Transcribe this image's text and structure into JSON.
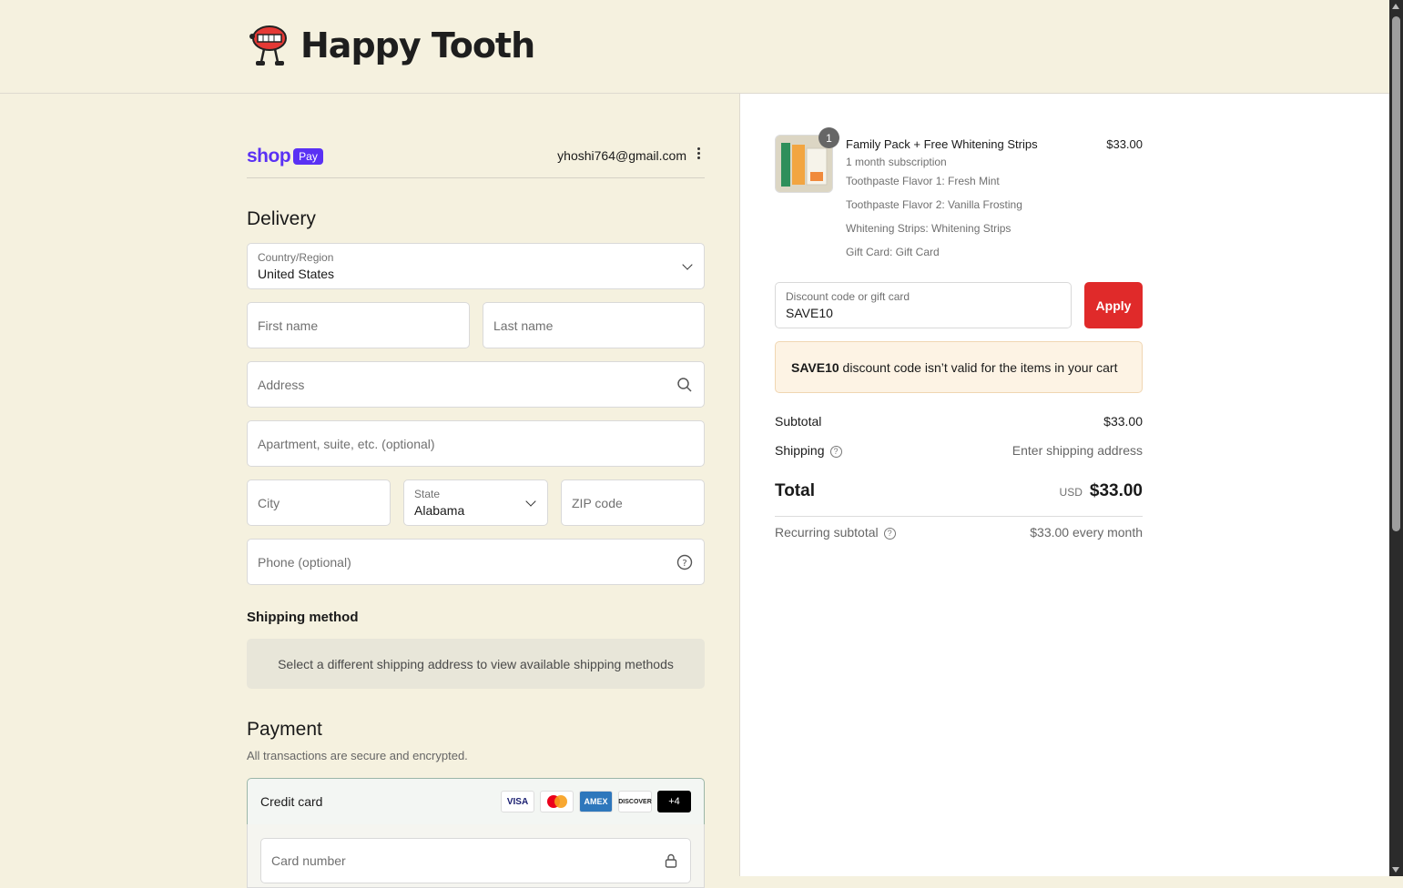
{
  "brand": {
    "name": "Happy Tooth"
  },
  "shoppay": {
    "logo_word": "shop",
    "badge": "Pay",
    "email": "yhoshi764@gmail.com"
  },
  "delivery": {
    "title": "Delivery",
    "country": {
      "label": "Country/Region",
      "value": "United States"
    },
    "first_name": {
      "placeholder": "First name"
    },
    "last_name": {
      "placeholder": "Last name"
    },
    "address": {
      "placeholder": "Address"
    },
    "apartment": {
      "placeholder": "Apartment, suite, etc. (optional)"
    },
    "city": {
      "placeholder": "City"
    },
    "state": {
      "label": "State",
      "value": "Alabama"
    },
    "zip": {
      "placeholder": "ZIP code"
    },
    "phone": {
      "placeholder": "Phone (optional)"
    }
  },
  "shipping_method": {
    "title": "Shipping method",
    "message": "Select a different shipping address to view available shipping methods"
  },
  "payment": {
    "title": "Payment",
    "subtitle": "All transactions are secure and encrypted.",
    "credit_card_label": "Credit card",
    "cards": [
      "VISA",
      "Mastercard",
      "AMEX",
      "DISCOVER",
      "+4"
    ],
    "card_number": {
      "placeholder": "Card number"
    }
  },
  "order": {
    "item": {
      "quantity": "1",
      "name": "Family Pack + Free Whitening Strips",
      "subscription": "1 month subscription",
      "options": [
        "Toothpaste Flavor 1: Fresh Mint",
        "Toothpaste Flavor 2: Vanilla Frosting",
        "Whitening Strips: Whitening Strips",
        "Gift Card: Gift Card"
      ],
      "price": "$33.00"
    },
    "discount": {
      "label": "Discount code or gift card",
      "value": "SAVE10",
      "apply_label": "Apply"
    },
    "error": {
      "code": "SAVE10",
      "message": " discount code isn’t valid for the items in your cart"
    },
    "subtotal": {
      "label": "Subtotal",
      "value": "$33.00"
    },
    "shipping": {
      "label": "Shipping",
      "value": "Enter shipping address"
    },
    "total": {
      "label": "Total",
      "currency": "USD",
      "value": "$33.00"
    },
    "recurring": {
      "label": "Recurring subtotal",
      "value": "$33.00 every month"
    }
  },
  "colors": {
    "background": "#f5f1df",
    "accent": "#e02a2a",
    "shop_pay": "#5a31f4"
  }
}
